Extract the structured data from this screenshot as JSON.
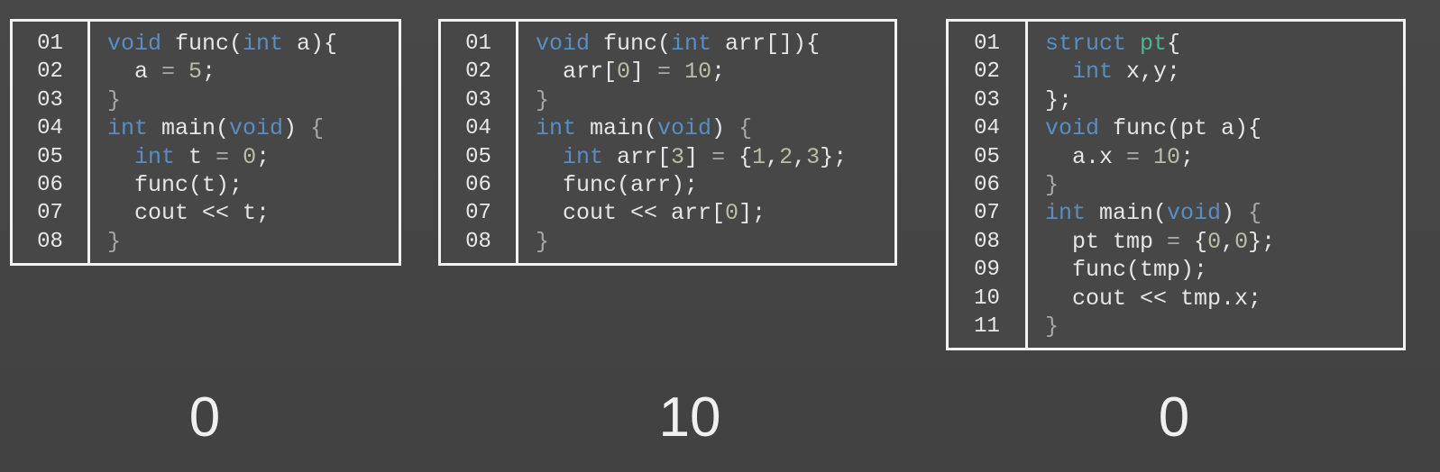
{
  "panels": [
    {
      "line_numbers": [
        "01",
        "02",
        "03",
        "04",
        "05",
        "06",
        "07",
        "08"
      ],
      "lines": [
        [
          [
            "void",
            "kw"
          ],
          [
            " func(",
            "tx"
          ],
          [
            "int",
            "kw"
          ],
          [
            " a){",
            "tx"
          ]
        ],
        [
          [
            "  a ",
            "tx"
          ],
          [
            "=",
            "pn"
          ],
          [
            " ",
            "tx"
          ],
          [
            "5",
            "num"
          ],
          [
            ";",
            "tx"
          ]
        ],
        [
          [
            "}",
            "pn"
          ]
        ],
        [
          [
            "int",
            "kw"
          ],
          [
            " main(",
            "tx"
          ],
          [
            "void",
            "kw"
          ],
          [
            ") ",
            "tx"
          ],
          [
            "{",
            "pn"
          ]
        ],
        [
          [
            "  ",
            "tx"
          ],
          [
            "int",
            "kw"
          ],
          [
            " t ",
            "tx"
          ],
          [
            "=",
            "pn"
          ],
          [
            " ",
            "tx"
          ],
          [
            "0",
            "num"
          ],
          [
            ";",
            "tx"
          ]
        ],
        [
          [
            "  func(t);",
            "tx"
          ]
        ],
        [
          [
            "  cout << t;",
            "tx"
          ]
        ],
        [
          [
            "}",
            "pn"
          ]
        ]
      ],
      "result": "0"
    },
    {
      "line_numbers": [
        "01",
        "02",
        "03",
        "04",
        "05",
        "06",
        "07",
        "08"
      ],
      "lines": [
        [
          [
            "void",
            "kw"
          ],
          [
            " func(",
            "tx"
          ],
          [
            "int",
            "kw"
          ],
          [
            " arr[]){",
            "tx"
          ]
        ],
        [
          [
            "  arr[",
            "tx"
          ],
          [
            "0",
            "num"
          ],
          [
            "] ",
            "tx"
          ],
          [
            "=",
            "pn"
          ],
          [
            " ",
            "tx"
          ],
          [
            "10",
            "num"
          ],
          [
            ";",
            "tx"
          ]
        ],
        [
          [
            "}",
            "pn"
          ]
        ],
        [
          [
            "int",
            "kw"
          ],
          [
            " main(",
            "tx"
          ],
          [
            "void",
            "kw"
          ],
          [
            ") ",
            "tx"
          ],
          [
            "{",
            "pn"
          ]
        ],
        [
          [
            "  ",
            "tx"
          ],
          [
            "int",
            "kw"
          ],
          [
            " arr[",
            "tx"
          ],
          [
            "3",
            "num"
          ],
          [
            "] ",
            "tx"
          ],
          [
            "=",
            "pn"
          ],
          [
            " {",
            "tx"
          ],
          [
            "1",
            "num"
          ],
          [
            ",",
            "tx"
          ],
          [
            "2",
            "num"
          ],
          [
            ",",
            "tx"
          ],
          [
            "3",
            "num"
          ],
          [
            "};",
            "tx"
          ]
        ],
        [
          [
            "  func(arr);",
            "tx"
          ]
        ],
        [
          [
            "  cout << arr[",
            "tx"
          ],
          [
            "0",
            "num"
          ],
          [
            "];",
            "tx"
          ]
        ],
        [
          [
            "}",
            "pn"
          ]
        ]
      ],
      "result": "10"
    },
    {
      "line_numbers": [
        "01",
        "02",
        "03",
        "04",
        "05",
        "06",
        "07",
        "08",
        "09",
        "10",
        "11"
      ],
      "lines": [
        [
          [
            "struct",
            "kw"
          ],
          [
            " ",
            "tx"
          ],
          [
            "pt",
            "ty"
          ],
          [
            "{",
            "tx"
          ]
        ],
        [
          [
            "  ",
            "tx"
          ],
          [
            "int",
            "kw"
          ],
          [
            " x,y;",
            "tx"
          ]
        ],
        [
          [
            "};",
            "tx"
          ]
        ],
        [
          [
            "void",
            "kw"
          ],
          [
            " func(pt a){",
            "tx"
          ]
        ],
        [
          [
            "  a.x ",
            "tx"
          ],
          [
            "=",
            "pn"
          ],
          [
            " ",
            "tx"
          ],
          [
            "10",
            "num"
          ],
          [
            ";",
            "tx"
          ]
        ],
        [
          [
            "}",
            "pn"
          ]
        ],
        [
          [
            "int",
            "kw"
          ],
          [
            " main(",
            "tx"
          ],
          [
            "void",
            "kw"
          ],
          [
            ") ",
            "tx"
          ],
          [
            "{",
            "pn"
          ]
        ],
        [
          [
            "  pt tmp ",
            "tx"
          ],
          [
            "=",
            "pn"
          ],
          [
            " {",
            "tx"
          ],
          [
            "0",
            "num"
          ],
          [
            ",",
            "tx"
          ],
          [
            "0",
            "num"
          ],
          [
            "};",
            "tx"
          ]
        ],
        [
          [
            "  func(tmp);",
            "tx"
          ]
        ],
        [
          [
            "  cout << tmp.x;",
            "tx"
          ]
        ],
        [
          [
            "}",
            "pn"
          ]
        ]
      ],
      "result": "0"
    }
  ]
}
